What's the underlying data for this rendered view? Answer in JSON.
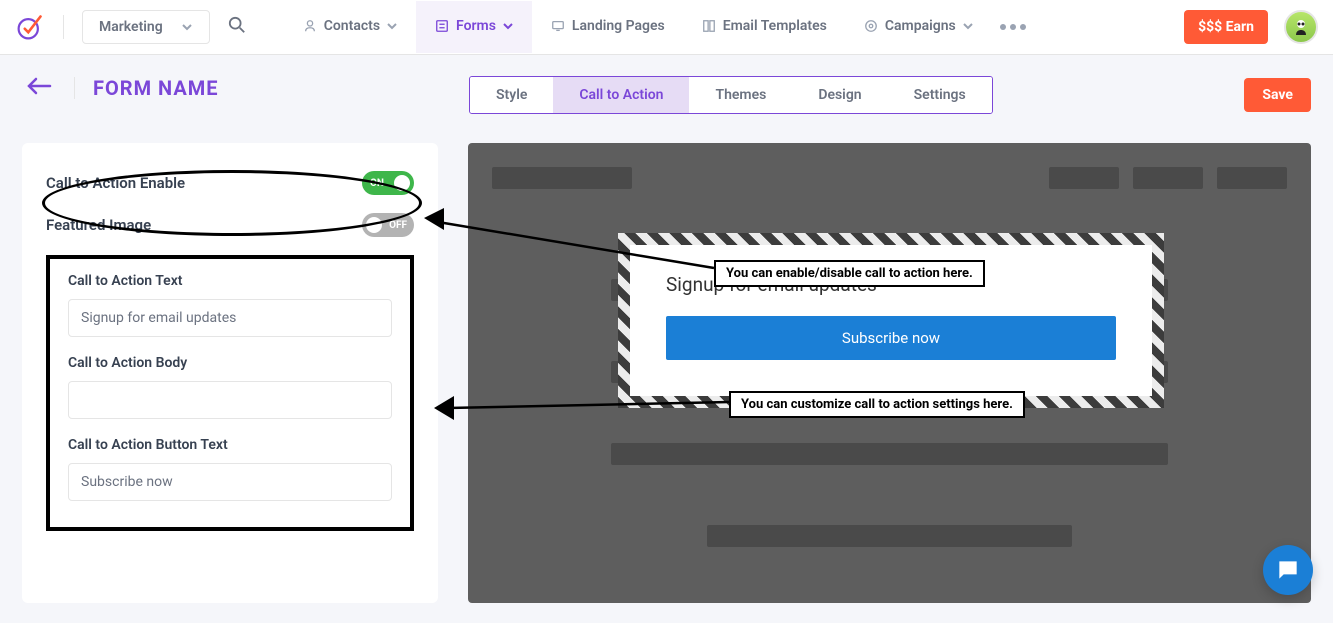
{
  "topbar": {
    "workspace_select": "Marketing",
    "nav": {
      "contacts": "Contacts",
      "forms": "Forms",
      "landing_pages": "Landing Pages",
      "email_templates": "Email Templates",
      "campaigns": "Campaigns"
    },
    "earn_label": "$$$ Earn"
  },
  "page": {
    "title": "FORM NAME",
    "tabs": {
      "style": "Style",
      "cta": "Call to Action",
      "themes": "Themes",
      "design": "Design",
      "settings": "Settings"
    },
    "save_label": "Save"
  },
  "sidebar": {
    "cta_enable_label": "Call to Action Enable",
    "cta_enable_state": "ON",
    "featured_image_label": "Featured Image",
    "featured_image_state": "OFF",
    "cta_text_label": "Call to Action Text",
    "cta_text_value": "Signup for email updates",
    "cta_body_label": "Call to Action Body",
    "cta_body_value": "",
    "cta_button_label": "Call to Action Button Text",
    "cta_button_value": "Subscribe now"
  },
  "preview": {
    "cta_title": "Signup for email updates",
    "cta_button": "Subscribe now"
  },
  "annotations": {
    "enable": "You can enable/disable call to action here.",
    "customize": "You can customize call to action settings here."
  }
}
